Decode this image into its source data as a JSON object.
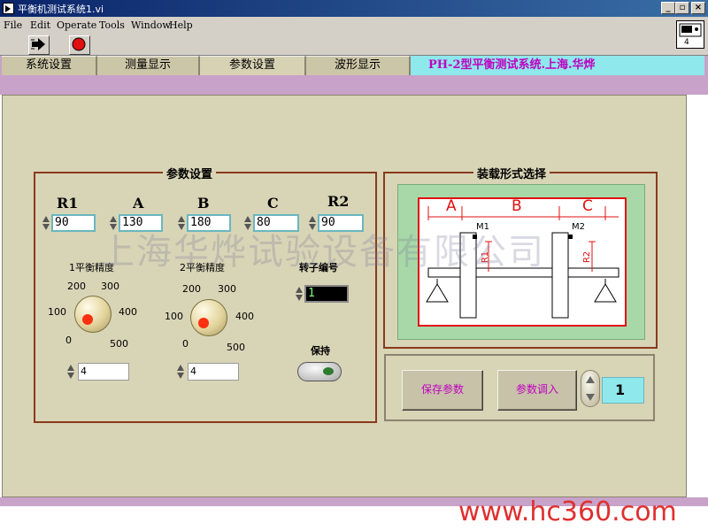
{
  "window": {
    "title": "平衡机测试系统1.vi",
    "minimize_label": "_",
    "restore_label": "▫",
    "close_label": "×"
  },
  "menu": [
    "File",
    "Edit",
    "Operate",
    "Tools",
    "Window",
    "Help"
  ],
  "toolbar": {
    "run_icon": "run-arrow-icon",
    "stop_icon": "stop-icon",
    "vi_icon_number": "4"
  },
  "tabs": [
    "系统设置",
    "测量显示",
    "参数设置",
    "波形显示"
  ],
  "active_tab": "参数设置",
  "banner": "PH-2型平衡测试系统.上海.华烨",
  "params": {
    "title": "参数设置",
    "fields": [
      {
        "label": "R1",
        "value": "90"
      },
      {
        "label": "A",
        "value": "130"
      },
      {
        "label": "B",
        "value": "180"
      },
      {
        "label": "C",
        "value": "80"
      },
      {
        "label": "R2",
        "value": "90"
      }
    ],
    "knob1": {
      "label": "1平衡精度",
      "ticks": [
        "0",
        "100",
        "200",
        "300",
        "400",
        "500"
      ],
      "value": "4"
    },
    "knob2": {
      "label": "2平衡精度",
      "ticks": [
        "0",
        "100",
        "200",
        "300",
        "400",
        "500"
      ],
      "value": "4"
    },
    "rotor": {
      "label": "转子编号",
      "value": "1"
    },
    "hold": {
      "label": "保持"
    }
  },
  "mount": {
    "title": "装载形式选择",
    "diagram_labels": {
      "A": "A",
      "B": "B",
      "C": "C",
      "M1": "M1",
      "M2": "M2",
      "R1": "R1",
      "R2": "R2"
    }
  },
  "actions": {
    "save_label": "保存参数",
    "load_label": "参数调入",
    "index_value": "1"
  },
  "watermark": "上海华烨试验设备有限公司",
  "footer_url": "www.hc360.com",
  "colors": {
    "panel_bg": "#d8d4b6",
    "band": "#c8a2c8",
    "banner_bg": "#8fe8ec",
    "banner_text": "#c000c0",
    "group_border": "#8a3a1c",
    "diagram_red": "#e01010",
    "url_red": "#e03030"
  }
}
